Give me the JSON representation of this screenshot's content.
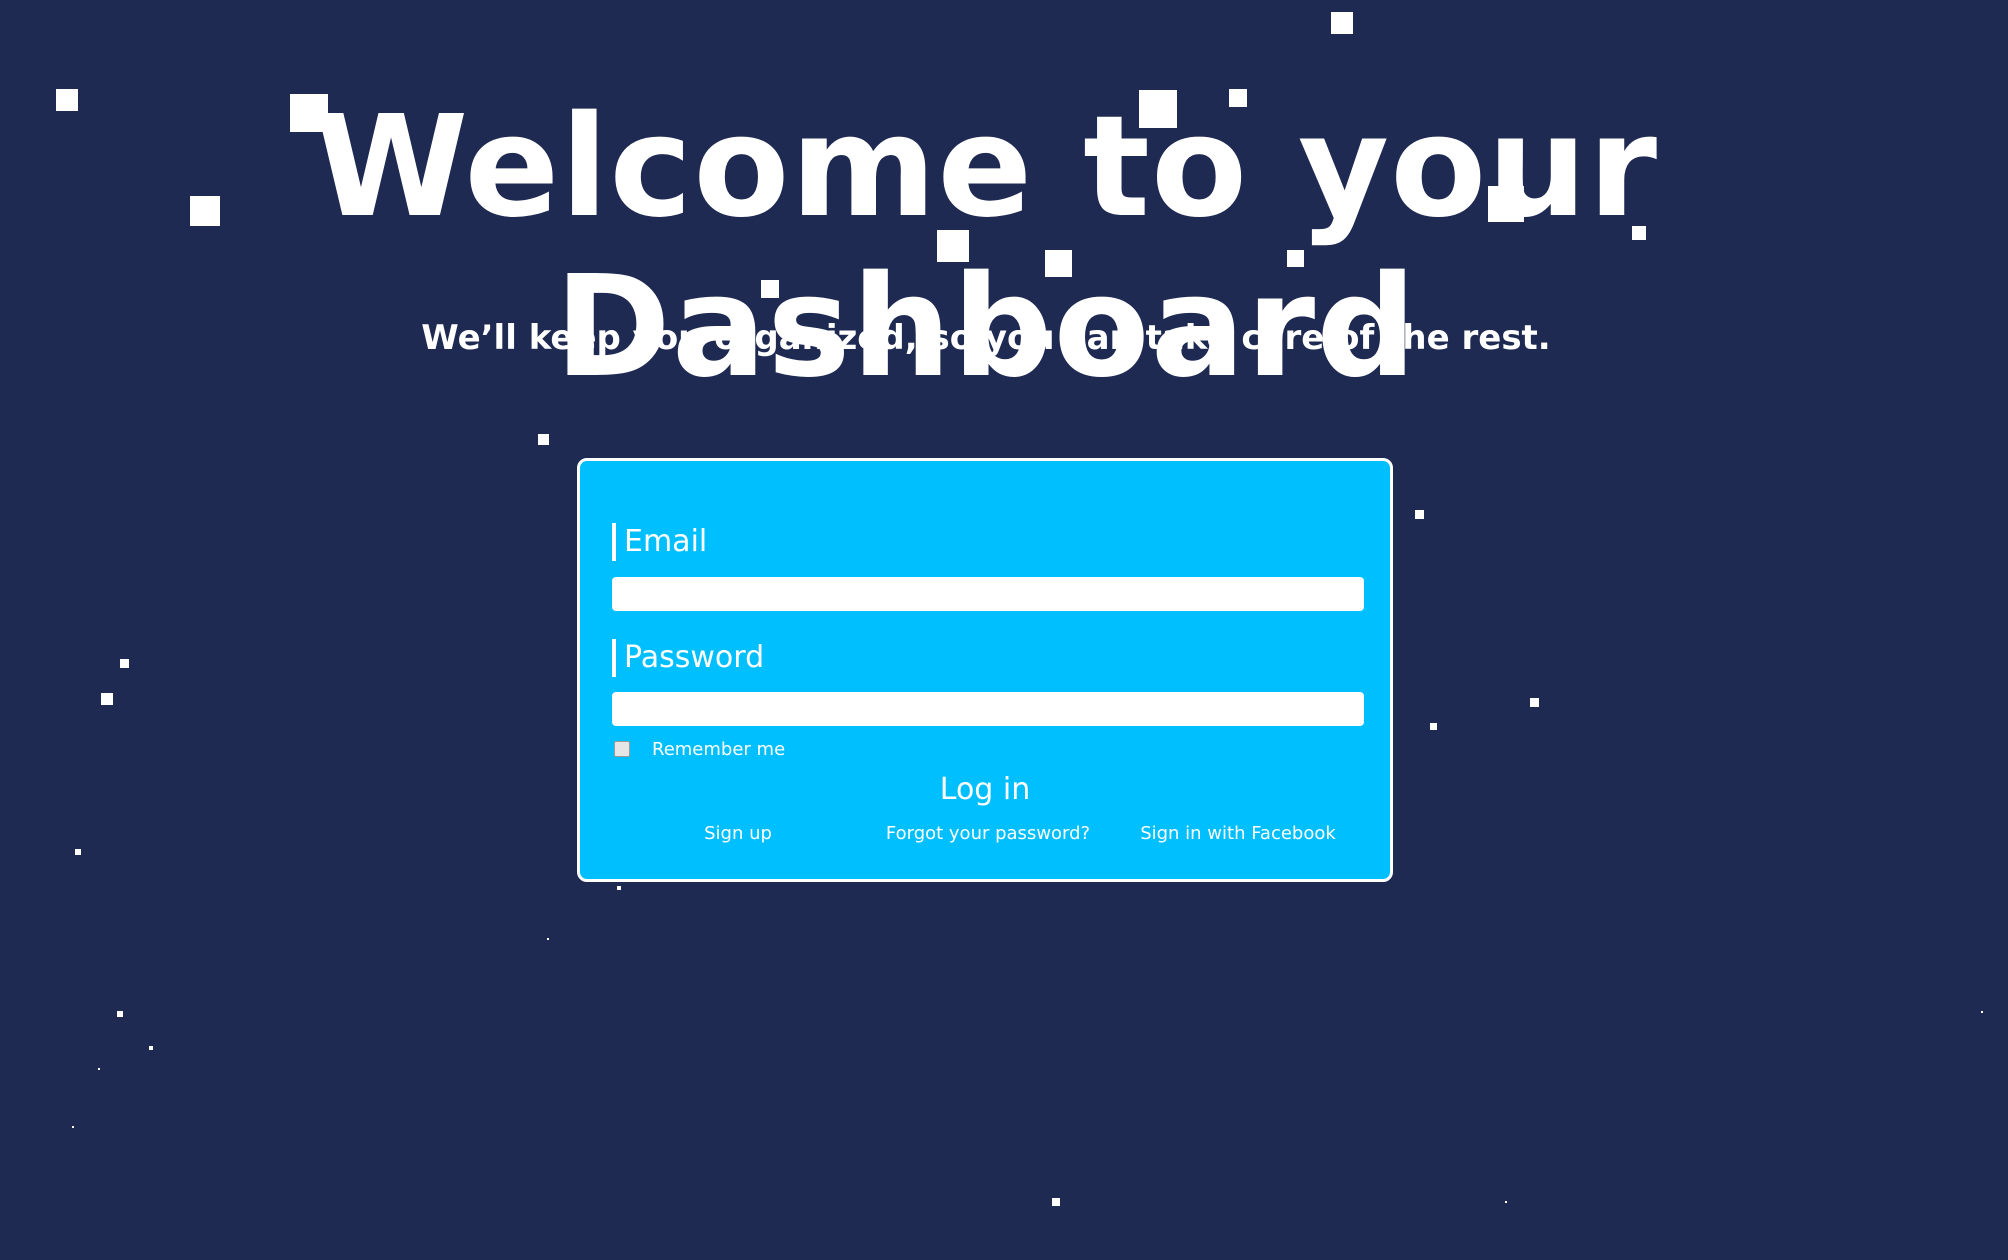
{
  "hero": {
    "title": "Welcome to your Dashboard",
    "subtitle": "We’ll keep you organized, so you can take care of the rest."
  },
  "login": {
    "email_label": "Email",
    "email_value": "",
    "password_label": "Password",
    "password_value": "",
    "remember_label": "Remember me",
    "remember_checked": false,
    "submit_label": "Log in",
    "links": {
      "signup": "Sign up",
      "forgot": "Forgot your password?",
      "facebook": "Sign in with Facebook"
    }
  },
  "colors": {
    "background": "#1f2a52",
    "card": "#00bfff",
    "text": "#ffffff"
  }
}
